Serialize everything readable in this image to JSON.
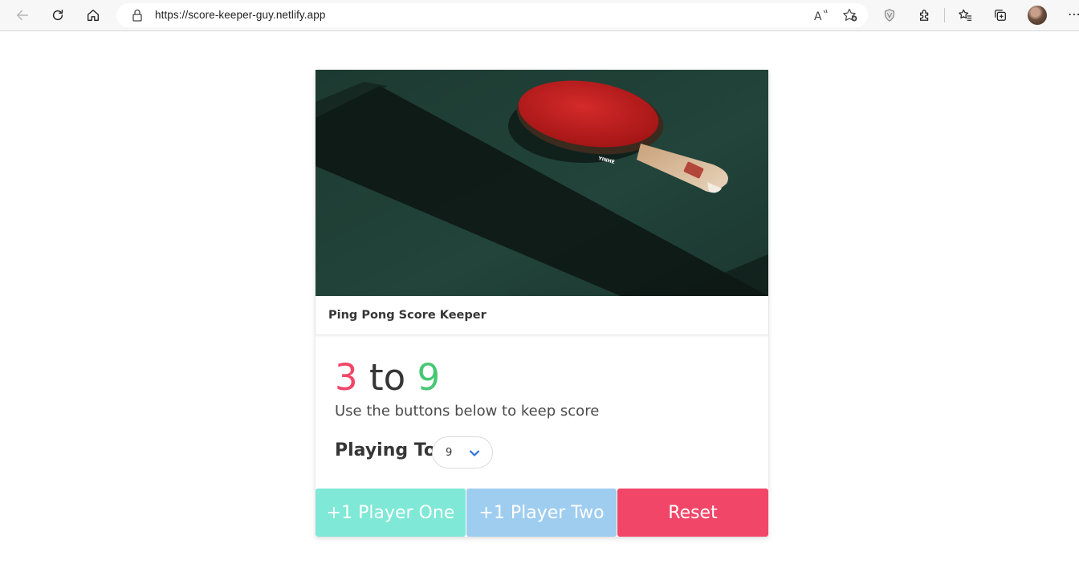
{
  "browser": {
    "url": "https://score-keeper-guy.netlify.app",
    "icons": [
      "back-icon",
      "refresh-icon",
      "home-icon",
      "lock-icon",
      "read-aloud-icon",
      "favorite-add-icon",
      "shield-icon",
      "extensions-icon",
      "favorites-icon",
      "collections-icon",
      "profile-avatar",
      "more-icon"
    ]
  },
  "card": {
    "title": "Ping Pong Score Keeper",
    "score": {
      "player_one": "3",
      "separator": "to",
      "player_two": "9"
    },
    "subtitle": "Use the buttons below to keep score",
    "playing_to_label": "Playing To",
    "playing_to_value": "9",
    "buttons": {
      "player_one": "+1 Player One",
      "player_two": "+1 Player Two",
      "reset": "Reset"
    }
  },
  "colors": {
    "player_one": "#f14668",
    "player_two": "#48c774",
    "btn_player_one": "#7fe8d6",
    "btn_player_two": "#9ecdf0",
    "btn_reset": "#f14668"
  }
}
